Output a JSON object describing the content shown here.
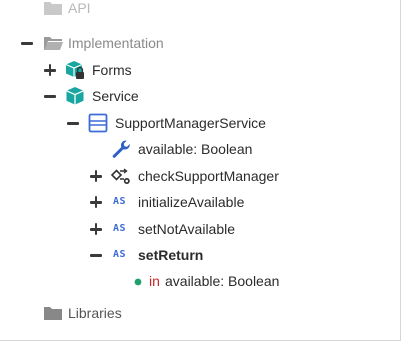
{
  "tree": {
    "api": {
      "label": "API",
      "icon": "folder-icon"
    },
    "implementation": {
      "label": "Implementation",
      "icon": "open-folder-icon"
    },
    "forms": {
      "label": "Forms",
      "icon": "locked-package-icon"
    },
    "service": {
      "label": "Service",
      "icon": "package-icon"
    },
    "support_manager_service": {
      "label": "SupportManagerService",
      "icon": "class-icon"
    },
    "available_attr": {
      "label": "available: Boolean",
      "icon": "wrench-icon"
    },
    "check_support_manager": {
      "label": "checkSupportManager",
      "icon": "decision-flow-icon"
    },
    "initialize_available": {
      "label": "initializeAvailable",
      "badge": "AS"
    },
    "set_not_available": {
      "label": "setNotAvailable",
      "badge": "AS"
    },
    "set_return": {
      "label": "setReturn",
      "badge": "AS"
    },
    "param": {
      "direction": "in",
      "label": "available: Boolean",
      "icon": "dot-icon"
    },
    "libraries": {
      "label": "Libraries",
      "icon": "folder-icon"
    }
  },
  "colors": {
    "accent": "#3d6bd8",
    "package": "#1aa6a0",
    "keyword": "#c62828",
    "param_dot": "#21a06e"
  }
}
